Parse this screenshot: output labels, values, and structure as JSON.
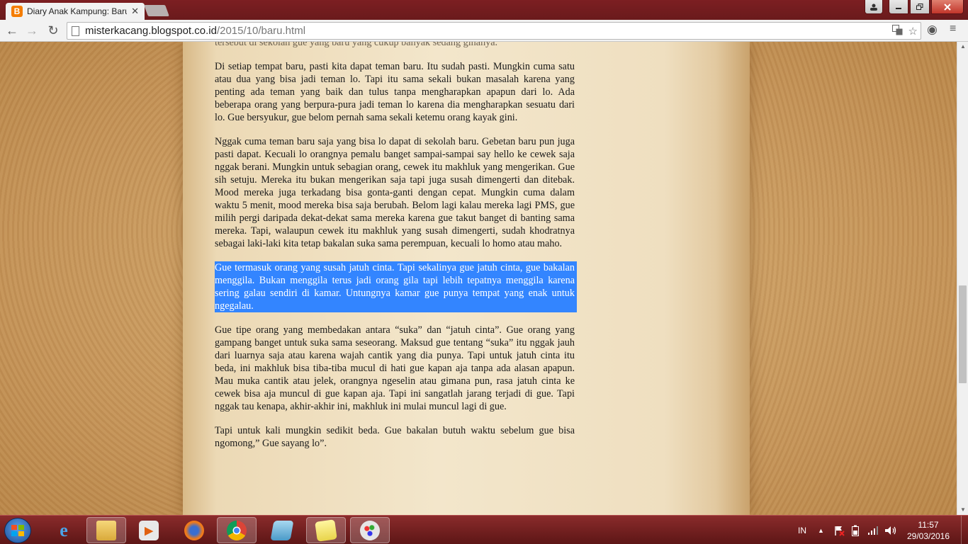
{
  "browser": {
    "tab_title": "Diary Anak Kampung: Baru",
    "tab_close": "✕",
    "url_domain": "misterkacang.blogspot.co.id",
    "url_path": "/2015/10/baru.html"
  },
  "article": {
    "top_fragment": "tersebut di sekolah gue yang baru yang cukup banyak sedang ginanya.",
    "paragraphs": [
      "Di setiap tempat baru, pasti kita dapat teman baru. Itu sudah pasti. Mungkin cuma satu atau dua yang bisa jadi teman lo. Tapi itu sama sekali bukan masalah karena yang penting ada teman yang baik dan tulus tanpa mengharapkan apapun dari lo. Ada beberapa orang yang berpura-pura jadi teman lo karena dia mengharapkan sesuatu dari lo. Gue bersyukur, gue belom pernah sama sekali ketemu orang kayak gini.",
      "Nggak cuma teman baru saja yang bisa lo dapat di sekolah baru. Gebetan baru pun juga pasti dapat. Kecuali lo orangnya pemalu banget sampai-sampai say hello ke cewek saja nggak berani. Mungkin untuk sebagian orang, cewek itu makhluk yang mengerikan. Gue sih setuju. Mereka itu bukan mengerikan saja tapi juga susah dimengerti dan ditebak. Mood mereka juga terkadang bisa gonta-ganti dengan cepat. Mungkin cuma dalam waktu 5 menit, mood mereka bisa saja berubah. Belom lagi kalau mereka lagi PMS, gue milih pergi daripada dekat-dekat sama mereka karena gue takut banget di banting sama mereka. Tapi, walaupun cewek itu makhluk yang susah dimengerti, sudah khodratnya sebagai laki-laki kita tetap bakalan suka sama perempuan, kecuali lo homo atau maho.",
      "Gue termasuk orang yang susah jatuh cinta. Tapi sekalinya gue jatuh cinta, gue bakalan menggila. Bukan menggila terus jadi orang gila tapi lebih tepatnya menggila karena sering galau sendiri di kamar. Untungnya kamar gue punya tempat yang enak untuk ngegalau.",
      "Gue tipe orang yang membedakan antara “suka” dan “jatuh cinta”. Gue orang yang gampang banget untuk suka sama seseorang. Maksud gue tentang “suka” itu nggak jauh dari luarnya saja atau karena wajah cantik yang dia punya. Tapi untuk jatuh cinta itu beda, ini makhluk bisa tiba-tiba mucul di hati gue kapan aja tanpa ada alasan apapun. Mau muka cantik atau jelek, orangnya ngeselin atau gimana pun, rasa jatuh cinta ke cewek bisa aja muncul di gue kapan aja. Tapi ini sangatlah jarang terjadi di gue. Tapi nggak tau kenapa, akhir-akhir ini, makhluk ini mulai muncul lagi di gue.",
      "Tapi untuk kali mungkin sedikit beda. Gue bakalan butuh waktu sebelum gue bisa ngomong,” Gue sayang lo”."
    ]
  },
  "taskbar": {
    "language": "IN",
    "time": "11:57",
    "date": "29/03/2016"
  },
  "colors": {
    "selection": "#3385ff",
    "taskbar": "#6a1a1c",
    "titlebar": "#7c1f22"
  }
}
